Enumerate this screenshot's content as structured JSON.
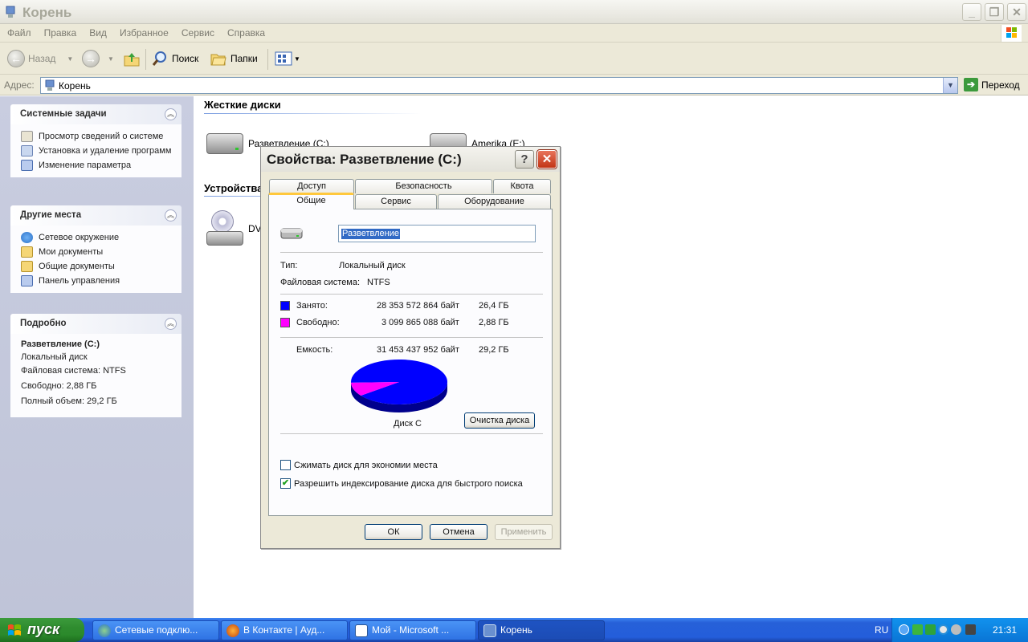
{
  "window": {
    "title": "Корень"
  },
  "menu": [
    "Файл",
    "Правка",
    "Вид",
    "Избранное",
    "Сервис",
    "Справка"
  ],
  "toolbar": {
    "back": "Назад",
    "search": "Поиск",
    "folders": "Папки"
  },
  "address": {
    "label": "Адрес:",
    "value": "Корень",
    "go": "Переход"
  },
  "sidebar": {
    "system_tasks": {
      "title": "Системные задачи",
      "items": [
        "Просмотр сведений о системе",
        "Установка и удаление программ",
        "Изменение параметра"
      ]
    },
    "other_places": {
      "title": "Другие места",
      "items": [
        "Сетевое окружение",
        "Мои документы",
        "Общие документы",
        "Панель управления"
      ]
    },
    "details": {
      "title": "Подробно",
      "name": "Разветвление (C:)",
      "type": "Локальный диск",
      "fs": "Файловая система: NTFS",
      "free": "Свободно: 2,88 ГБ",
      "total": "Полный объем: 29,2 ГБ"
    }
  },
  "content": {
    "groups": {
      "hard_drives": "Жесткие диски",
      "devices": "Устройства"
    },
    "drives": [
      {
        "label": "Разветвление (C:)"
      },
      {
        "label": "Amerika (E:)"
      }
    ],
    "devices": [
      {
        "label": "DV"
      }
    ]
  },
  "dialog": {
    "title": "Свойства: Разветвление (C:)",
    "tabs_top": [
      "Доступ",
      "Безопасность",
      "Квота"
    ],
    "tabs_bottom": [
      "Общие",
      "Сервис",
      "Оборудование"
    ],
    "active_tab": "Общие",
    "name_value": "Разветвление",
    "type_label": "Тип:",
    "type_value": "Локальный диск",
    "fs_label": "Файловая система:",
    "fs_value": "NTFS",
    "used_label": "Занято:",
    "used_bytes": "28 353 572 864 байт",
    "used_gb": "26,4 ГБ",
    "free_label": "Свободно:",
    "free_bytes": "3 099 865 088 байт",
    "free_gb": "2,88 ГБ",
    "capacity_label": "Емкость:",
    "capacity_bytes": "31 453 437 952 байт",
    "capacity_gb": "29,2 ГБ",
    "disk_label": "Диск C",
    "cleanup": "Очистка диска",
    "compress": "Сжимать диск для экономии места",
    "compress_checked": false,
    "index": "Разрешить индексирование диска для быстрого поиска",
    "index_checked": true,
    "ok": "ОК",
    "cancel": "Отмена",
    "apply": "Применить",
    "used_fraction": 0.9014,
    "colors": {
      "used": "#0000ff",
      "free": "#ff00ff"
    }
  },
  "taskbar": {
    "start": "пуск",
    "tasks": [
      "Сетевые подклю...",
      "В Контакте | Ауд...",
      "Мой - Microsoft ...",
      "Корень"
    ],
    "lang": "RU",
    "clock": "21:31"
  }
}
